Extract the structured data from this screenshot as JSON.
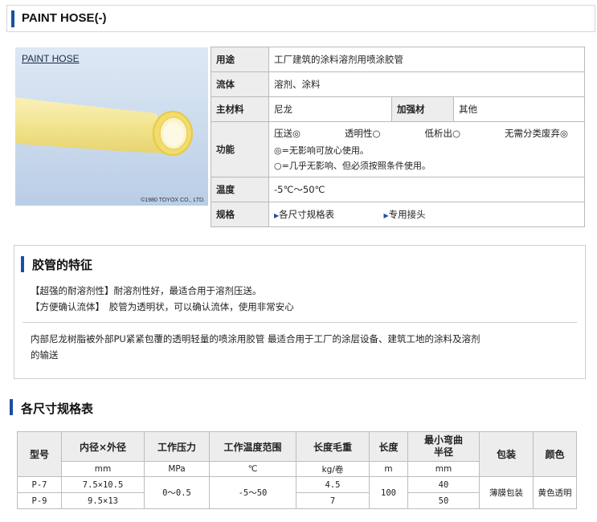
{
  "page": {
    "title": "PAINT HOSE(-)"
  },
  "photo": {
    "label": "PAINT HOSE",
    "copyright": "©1980 TOYOX CO., LTD."
  },
  "spec": {
    "usage_label": "用途",
    "usage": "工厂建筑的涂料溶剂用喷涂胶管",
    "fluid_label": "流体",
    "fluid": "溶剂、涂料",
    "material_label": "主材料",
    "material": "尼龙",
    "reinforce_label": "加强材",
    "reinforce": "其他",
    "function_label": "功能",
    "functions": [
      "压送◎",
      "透明性○",
      "低析出○",
      "无需分类废弃◎"
    ],
    "note1": "◎=无影响可放心使用。",
    "note2": "○=几乎无影响、但必须按照条件使用。",
    "temp_label": "温度",
    "temp": "-5℃～50℃",
    "spec_label": "规格",
    "link1": "各尺寸规格表",
    "link2": "专用接头"
  },
  "features": {
    "title": "胶管的特征",
    "line1": "【超强的耐溶剂性】耐溶剂性好，最适合用于溶剂压送。",
    "line2": "【方便确认流体】　胶管为透明状，可以确认流体，使用非常安心",
    "description": "内部尼龙树脂被外部PU紧紧包覆的透明轻量的喷涂用胶管 最适合用于工厂的涂层设备、建筑工地的涂料及溶剂的输送"
  },
  "sizes": {
    "title": "各尺寸规格表",
    "headers": [
      "型号",
      "内径×外径",
      "工作压力",
      "工作温度范围",
      "长度毛重",
      "长度",
      "最小弯曲半径",
      "包装",
      "颜色"
    ],
    "units": [
      "mm",
      "MPa",
      "℃",
      "kg/卷",
      "m",
      "mm"
    ],
    "rows": [
      {
        "model": "P-7",
        "size": "7.5×10.5",
        "weight": "4.5",
        "radius": "40"
      },
      {
        "model": "P-9",
        "size": "9.5×13",
        "weight": "7",
        "radius": "50"
      }
    ],
    "pressure": "0～0.5",
    "temp_range": "-5～50",
    "length": "100",
    "packaging": "薄膜包装",
    "color": "黄色透明"
  }
}
